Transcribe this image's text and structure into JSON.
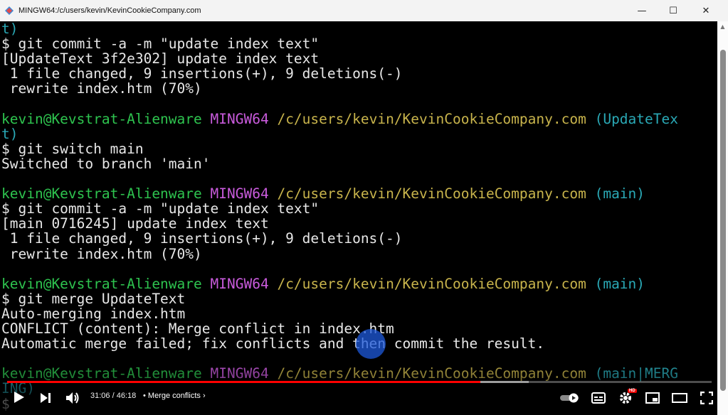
{
  "window": {
    "title": "MINGW64:/c/users/kevin/KevinCookieCompany.com",
    "minimize_glyph": "—",
    "maximize_glyph": "☐",
    "close_glyph": "✕"
  },
  "terminal": {
    "lines": [
      {
        "segments": [
          {
            "text": "t)",
            "color": "cyan"
          }
        ]
      },
      {
        "segments": [
          {
            "text": "$ git commit -a -m \"update index text\"",
            "color": "default"
          }
        ]
      },
      {
        "segments": [
          {
            "text": "[UpdateText 3f2e302] update index text",
            "color": "default"
          }
        ]
      },
      {
        "segments": [
          {
            "text": " 1 file changed, 9 insertions(+), 9 deletions(-)",
            "color": "default"
          }
        ]
      },
      {
        "segments": [
          {
            "text": " rewrite index.htm (70%)",
            "color": "default"
          }
        ]
      },
      {
        "segments": []
      },
      {
        "segments": [
          {
            "text": "kevin@Kevstrat-Alienware",
            "color": "green"
          },
          {
            "text": " ",
            "color": "default"
          },
          {
            "text": "MINGW64",
            "color": "magenta"
          },
          {
            "text": " ",
            "color": "default"
          },
          {
            "text": "/c/users/kevin/KevinCookieCompany.com",
            "color": "yellow"
          },
          {
            "text": " (UpdateTex",
            "color": "cyan"
          }
        ]
      },
      {
        "segments": [
          {
            "text": "t)",
            "color": "cyan"
          }
        ]
      },
      {
        "segments": [
          {
            "text": "$ git switch main",
            "color": "default"
          }
        ]
      },
      {
        "segments": [
          {
            "text": "Switched to branch 'main'",
            "color": "default"
          }
        ]
      },
      {
        "segments": []
      },
      {
        "segments": [
          {
            "text": "kevin@Kevstrat-Alienware",
            "color": "green"
          },
          {
            "text": " ",
            "color": "default"
          },
          {
            "text": "MINGW64",
            "color": "magenta"
          },
          {
            "text": " ",
            "color": "default"
          },
          {
            "text": "/c/users/kevin/KevinCookieCompany.com",
            "color": "yellow"
          },
          {
            "text": " (main)",
            "color": "cyan"
          }
        ]
      },
      {
        "segments": [
          {
            "text": "$ git commit -a -m \"update index text\"",
            "color": "default"
          }
        ]
      },
      {
        "segments": [
          {
            "text": "[main 0716245] update index text",
            "color": "default"
          }
        ]
      },
      {
        "segments": [
          {
            "text": " 1 file changed, 9 insertions(+), 9 deletions(-)",
            "color": "default"
          }
        ]
      },
      {
        "segments": [
          {
            "text": " rewrite index.htm (70%)",
            "color": "default"
          }
        ]
      },
      {
        "segments": []
      },
      {
        "segments": [
          {
            "text": "kevin@Kevstrat-Alienware",
            "color": "green"
          },
          {
            "text": " ",
            "color": "default"
          },
          {
            "text": "MINGW64",
            "color": "magenta"
          },
          {
            "text": " ",
            "color": "default"
          },
          {
            "text": "/c/users/kevin/KevinCookieCompany.com",
            "color": "yellow"
          },
          {
            "text": " (main)",
            "color": "cyan"
          }
        ]
      },
      {
        "segments": [
          {
            "text": "$ git merge UpdateText",
            "color": "default"
          }
        ]
      },
      {
        "segments": [
          {
            "text": "Auto-merging index.htm",
            "color": "default"
          }
        ]
      },
      {
        "segments": [
          {
            "text": "CONFLICT (content): Merge conflict in index.htm",
            "color": "default"
          }
        ]
      },
      {
        "segments": [
          {
            "text": "Automatic merge failed; fix conflicts and then commit the result.",
            "color": "default"
          }
        ]
      },
      {
        "segments": []
      },
      {
        "segments": [
          {
            "text": "kevin@Kevstrat-Alienware",
            "color": "green"
          },
          {
            "text": " ",
            "color": "default"
          },
          {
            "text": "MINGW64",
            "color": "magenta"
          },
          {
            "text": " ",
            "color": "default"
          },
          {
            "text": "/c/users/kevin/KevinCookieCompany.com",
            "color": "yellow"
          },
          {
            "text": " (main|MERG",
            "color": "cyan"
          }
        ]
      },
      {
        "segments": [
          {
            "text": "ING)",
            "color": "cyan"
          }
        ]
      },
      {
        "segments": [
          {
            "text": "$",
            "color": "default"
          }
        ]
      }
    ]
  },
  "player": {
    "time_display": "31:06 / 46:18",
    "chapter_label": "• Merge conflicts",
    "chapter_chevron": "›",
    "progress_fraction": 0.6718,
    "buffer_fraction": 0.74,
    "hd_badge": "HD",
    "icons": [
      "play-icon",
      "next-icon",
      "volume-icon",
      "autoplay-toggle-icon",
      "subtitles-icon",
      "settings-icon",
      "miniplayer-icon",
      "theater-icon",
      "fullscreen-icon"
    ]
  },
  "colors": {
    "default": "#e8e8e8",
    "green": "#2ec44f",
    "magenta": "#c95bdc",
    "yellow": "#c8b44c",
    "cyan": "#2aa9b6",
    "progress": "#ff0000"
  }
}
